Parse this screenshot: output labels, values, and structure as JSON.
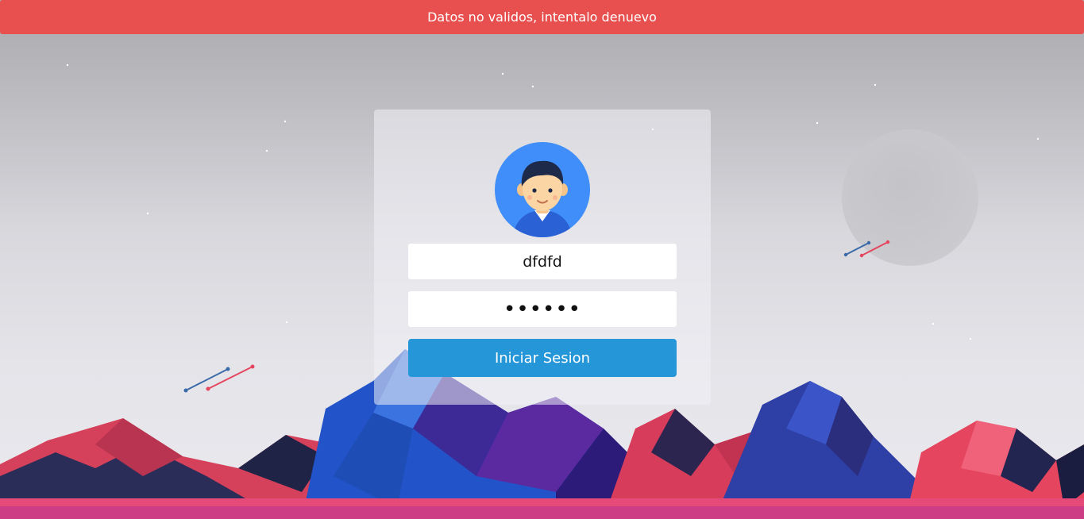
{
  "alert": {
    "message": "Datos no validos, intentalo denuevo"
  },
  "login_form": {
    "username_value": "dfdfd",
    "password_value": "123456",
    "submit_label": "Iniciar Sesion"
  },
  "colors": {
    "alert_bg": "#e8504f",
    "button_bg": "#2596d8",
    "avatar_bg": "#3f8ef9"
  }
}
